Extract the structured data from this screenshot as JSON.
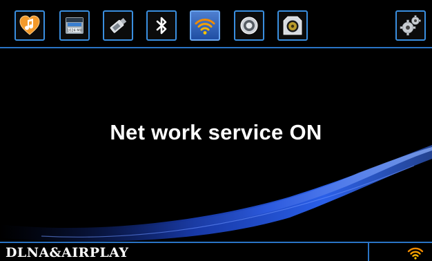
{
  "toolbar": {
    "items": [
      {
        "icon": "music-heart-icon",
        "selected": false
      },
      {
        "icon": "sd-card-icon",
        "selected": false,
        "card_text": "1024 MB"
      },
      {
        "icon": "usb-drive-icon",
        "selected": false
      },
      {
        "icon": "bluetooth-icon",
        "selected": false
      },
      {
        "icon": "wifi-network-icon",
        "selected": true
      },
      {
        "icon": "aux-input-icon",
        "selected": false
      },
      {
        "icon": "speaker-icon",
        "selected": false
      },
      {
        "icon": "settings-gears-icon",
        "selected": false
      }
    ]
  },
  "main": {
    "message": "Net work service ON"
  },
  "statusbar": {
    "mode": "DLNA&AIRPLAY",
    "indicator_icon": "wifi-signal-icon"
  },
  "colors": {
    "accent": "#2a74c6",
    "wifi_orange": "#f08a00",
    "background": "#000000"
  }
}
